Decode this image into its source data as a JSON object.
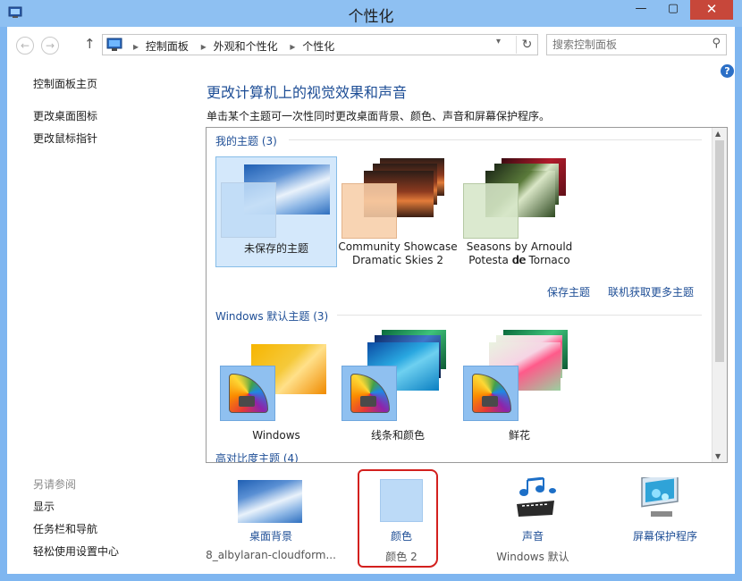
{
  "window": {
    "title": "个性化",
    "min_glyph": "—",
    "max_glyph": "▢",
    "close_glyph": "✕",
    "accent": "#8ec0f2",
    "close_color": "#c7473a"
  },
  "nav": {
    "back_glyph": "←",
    "forward_glyph": "→",
    "up_glyph": "↑",
    "breadcrumbs": [
      "控制面板",
      "外观和个性化",
      "个性化"
    ],
    "refresh_glyph": "↻",
    "search_placeholder": "搜索控制面板",
    "search_icon": "search-icon"
  },
  "help_glyph": "?",
  "sidebar": {
    "links": [
      "控制面板主页",
      "更改桌面图标",
      "更改鼠标指针"
    ],
    "see_also_title": "另请参阅",
    "see_also_links": [
      "显示",
      "任务栏和导航",
      "轻松使用设置中心"
    ]
  },
  "main": {
    "heading": "更改计算机上的视觉效果和声音",
    "description": "单击某个主题可一次性同时更改桌面背景、颜色、声音和屏幕保护程序。",
    "my_themes_title": "我的主题 (3)",
    "my_themes": [
      {
        "line1": "未保存的主题",
        "line2": ""
      },
      {
        "line1": "Community Showcase",
        "line2": "Dramatic Skies 2"
      },
      {
        "line1": "Seasons by Arnould de",
        "line2": "Potesta de Tornaco"
      }
    ],
    "save_theme_link": "保存主题",
    "get_more_link": "联机获取更多主题",
    "default_themes_title": "Windows 默认主题 (3)",
    "default_themes": [
      {
        "label": "Windows"
      },
      {
        "label": "线条和颜色"
      },
      {
        "label": "鲜花"
      }
    ],
    "high_contrast_title": "高对比度主题 (4)"
  },
  "bottom": {
    "background": {
      "title": "桌面背景",
      "subtitle": "8_albylaran-cloudform..."
    },
    "color": {
      "title": "颜色",
      "subtitle": "颜色 2",
      "swatch": "#bcdaf7"
    },
    "sound": {
      "title": "声音",
      "subtitle": "Windows 默认"
    },
    "screensaver": {
      "title": "屏幕保护程序"
    }
  }
}
